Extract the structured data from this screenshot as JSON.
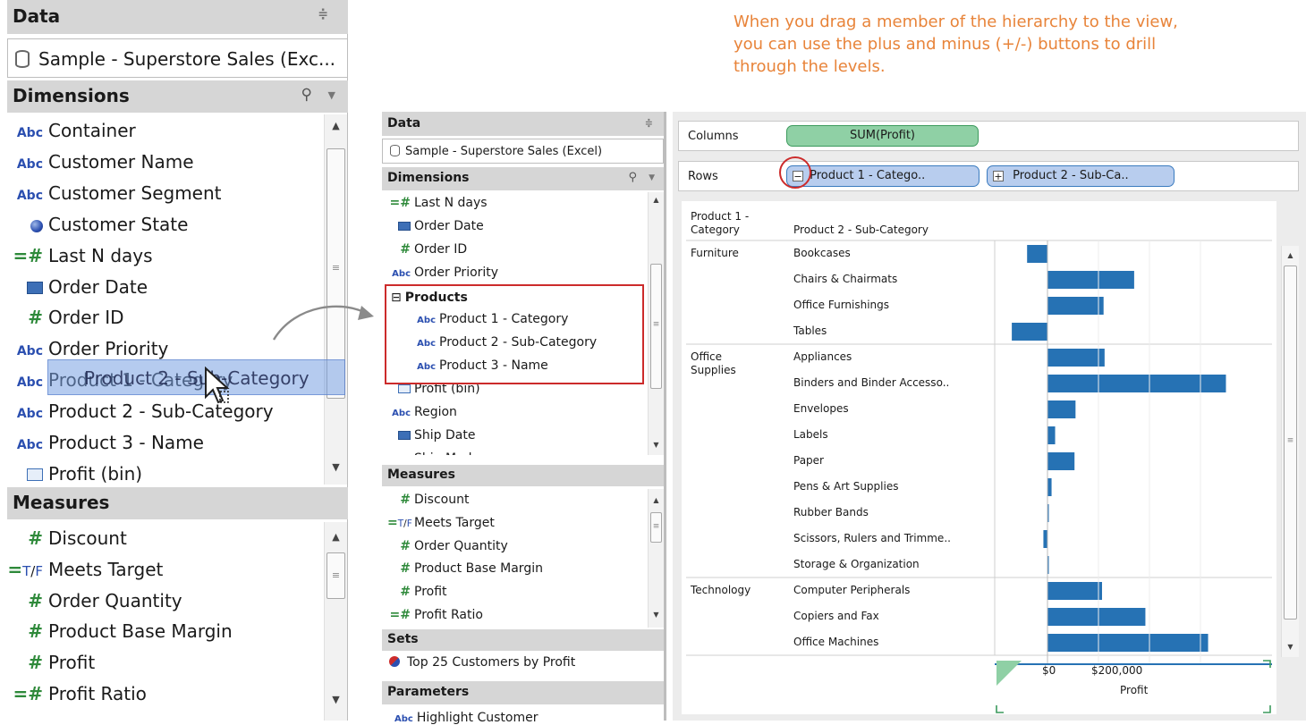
{
  "annotation": "When you drag a member of the hierarchy to the view, you can use the plus and minus (+/-) buttons to drill through the levels.",
  "colors": {
    "accent_orange": "#e8843a",
    "bar_blue": "#2672b4",
    "pill_green": "#8fd0a5",
    "pill_blue": "#b8cdee",
    "highlight_red": "#cc2b2b"
  },
  "left": {
    "data_title": "Data",
    "datasource": "Sample - Superstore Sales (Exc...",
    "dimensions_title": "Dimensions",
    "dimensions": [
      {
        "icon": "Abc",
        "label": "Container"
      },
      {
        "icon": "Abc",
        "label": "Customer Name"
      },
      {
        "icon": "Abc",
        "label": "Customer Segment"
      },
      {
        "icon": "globe",
        "label": "Customer State"
      },
      {
        "icon": "=#",
        "label": "Last N days"
      },
      {
        "icon": "calendar",
        "label": "Order Date"
      },
      {
        "icon": "#",
        "label": "Order ID"
      },
      {
        "icon": "Abc",
        "label": "Order Priority"
      },
      {
        "icon": "Abc",
        "label": "Product 1 - Category"
      },
      {
        "icon": "Abc",
        "label": "Product 2 - Sub-Category"
      },
      {
        "icon": "Abc",
        "label": "Product 3 - Name"
      },
      {
        "icon": "bin",
        "label": "Profit (bin)"
      }
    ],
    "drag_ghost": "Product 2 - Sub-Category",
    "measures_title": "Measures",
    "measures": [
      {
        "icon": "#",
        "label": "Discount"
      },
      {
        "icon": "=T/F",
        "label": "Meets Target"
      },
      {
        "icon": "#",
        "label": "Order Quantity"
      },
      {
        "icon": "#",
        "label": "Product Base Margin"
      },
      {
        "icon": "#",
        "label": "Profit"
      },
      {
        "icon": "=#",
        "label": "Profit Ratio"
      }
    ]
  },
  "mid": {
    "data_title": "Data",
    "datasource": "Sample - Superstore Sales (Excel)",
    "dimensions_title": "Dimensions",
    "dimensions": [
      {
        "icon": "=#",
        "label": "Last N days"
      },
      {
        "icon": "calendar",
        "label": "Order Date"
      },
      {
        "icon": "#",
        "label": "Order ID"
      },
      {
        "icon": "Abc",
        "label": "Order Priority"
      }
    ],
    "hierarchy": {
      "name": "Products",
      "expander": "⊟",
      "members": [
        "Product 1 - Category",
        "Product 2 - Sub-Category",
        "Product 3 - Name"
      ]
    },
    "dimensions_after": [
      {
        "icon": "bin",
        "label": "Profit (bin)"
      },
      {
        "icon": "Abc",
        "label": "Region"
      },
      {
        "icon": "calendar",
        "label": "Ship Date"
      },
      {
        "icon": "Abc",
        "label": "Ship Mode"
      }
    ],
    "measures_title": "Measures",
    "measures": [
      {
        "icon": "#",
        "label": "Discount"
      },
      {
        "icon": "=T/F",
        "label": "Meets Target"
      },
      {
        "icon": "#",
        "label": "Order Quantity"
      },
      {
        "icon": "#",
        "label": "Product Base Margin"
      },
      {
        "icon": "#",
        "label": "Profit"
      },
      {
        "icon": "=#",
        "label": "Profit Ratio"
      }
    ],
    "sets_title": "Sets",
    "sets": [
      {
        "icon": "set",
        "label": "Top 25 Customers by Profit"
      }
    ],
    "parameters_title": "Parameters",
    "parameters": [
      {
        "icon": "Abc",
        "label": "Highlight Customer"
      }
    ]
  },
  "view": {
    "columns_label": "Columns",
    "columns_pill": "SUM(Profit)",
    "rows_label": "Rows",
    "rows_pills": [
      {
        "btn": "−",
        "label": "Product 1 - Catego.."
      },
      {
        "btn": "+",
        "label": "Product 2 - Sub-Ca.."
      }
    ],
    "header_cat": "Product 1 -\nCategory",
    "header_sub": "Product 2 - Sub-Category",
    "axis_title": "Profit",
    "axis_ticks": [
      "$0",
      "$200,000"
    ]
  },
  "chart_data": {
    "type": "bar",
    "orientation": "horizontal",
    "xlabel": "Profit",
    "x_ticks": [
      "$0",
      "$200,000"
    ],
    "groups": [
      {
        "category": "Furniture",
        "rows": [
          {
            "label": "Bookcases",
            "value": -40000
          },
          {
            "label": "Chairs & Chairmats",
            "value": 170000
          },
          {
            "label": "Office Furnishings",
            "value": 110000
          },
          {
            "label": "Tables",
            "value": -70000
          }
        ]
      },
      {
        "category": "Office\nSupplies",
        "rows": [
          {
            "label": "Appliances",
            "value": 112000
          },
          {
            "label": "Binders and Binder Accesso..",
            "value": 350000
          },
          {
            "label": "Envelopes",
            "value": 55000
          },
          {
            "label": "Labels",
            "value": 15000
          },
          {
            "label": "Paper",
            "value": 53000
          },
          {
            "label": "Pens & Art Supplies",
            "value": 8000
          },
          {
            "label": "Rubber Bands",
            "value": 1500
          },
          {
            "label": "Scissors, Rulers and Trimme..",
            "value": -8000
          },
          {
            "label": "Storage & Organization",
            "value": 2000
          }
        ]
      },
      {
        "category": "Technology",
        "rows": [
          {
            "label": "Computer Peripherals",
            "value": 107000
          },
          {
            "label": "Copiers and Fax",
            "value": 192000
          },
          {
            "label": "Office Machines",
            "value": 315000
          }
        ]
      }
    ]
  }
}
